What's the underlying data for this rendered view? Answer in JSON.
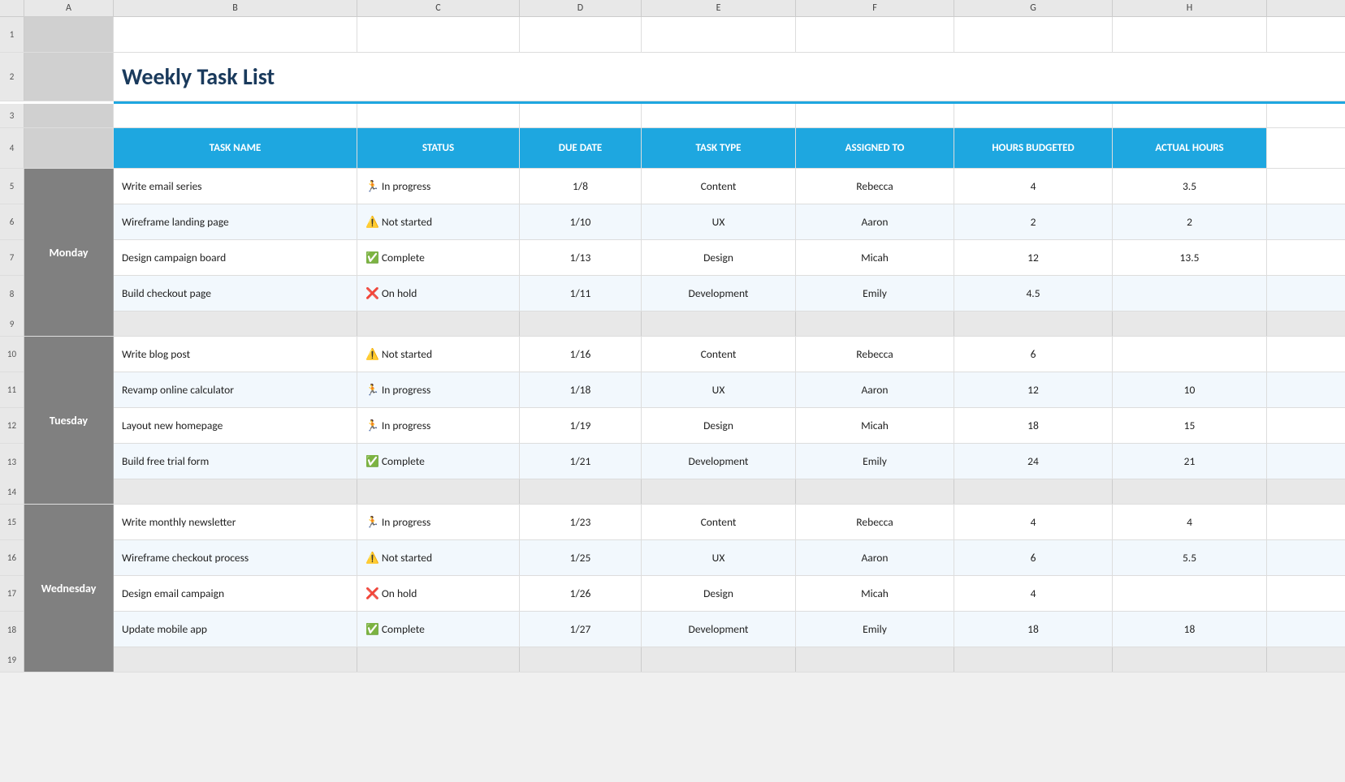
{
  "title": "Weekly Task List",
  "columns": {
    "rowNum": "#",
    "colA": "A",
    "colB": "B",
    "colC": "C",
    "colD": "D",
    "colE": "E",
    "colF": "F",
    "colG": "G",
    "colH": "H"
  },
  "headers": {
    "taskName": "TASK NAME",
    "status": "STATUS",
    "dueDate": "DUE DATE",
    "taskType": "TASK TYPE",
    "assignedTo": "ASSIGNED TO",
    "hoursBudgeted": "HOURS BUDGETED",
    "actualHours": "ACTUAL HOURS"
  },
  "groups": [
    {
      "day": "Monday",
      "startRow": 5,
      "rows": [
        {
          "rowNum": 5,
          "task": "Write email series",
          "statusIcon": "🏃",
          "status": "In progress",
          "dueDate": "1/8",
          "taskType": "Content",
          "assignedTo": "Rebecca",
          "hoursBudgeted": "4",
          "actualHours": "3.5"
        },
        {
          "rowNum": 6,
          "task": "Wireframe landing page",
          "statusIcon": "⚠️",
          "status": "Not started",
          "dueDate": "1/10",
          "taskType": "UX",
          "assignedTo": "Aaron",
          "hoursBudgeted": "2",
          "actualHours": "2"
        },
        {
          "rowNum": 7,
          "task": "Design campaign board",
          "statusIcon": "✅",
          "status": "Complete",
          "dueDate": "1/13",
          "taskType": "Design",
          "assignedTo": "Micah",
          "hoursBudgeted": "12",
          "actualHours": "13.5"
        },
        {
          "rowNum": 8,
          "task": "Build checkout page",
          "statusIcon": "❌",
          "status": "On hold",
          "dueDate": "1/11",
          "taskType": "Development",
          "assignedTo": "Emily",
          "hoursBudgeted": "4.5",
          "actualHours": ""
        }
      ],
      "emptyRow": 9
    },
    {
      "day": "Tuesday",
      "startRow": 10,
      "rows": [
        {
          "rowNum": 10,
          "task": "Write blog post",
          "statusIcon": "⚠️",
          "status": "Not started",
          "dueDate": "1/16",
          "taskType": "Content",
          "assignedTo": "Rebecca",
          "hoursBudgeted": "6",
          "actualHours": ""
        },
        {
          "rowNum": 11,
          "task": "Revamp online calculator",
          "statusIcon": "🏃",
          "status": "In progress",
          "dueDate": "1/18",
          "taskType": "UX",
          "assignedTo": "Aaron",
          "hoursBudgeted": "12",
          "actualHours": "10"
        },
        {
          "rowNum": 12,
          "task": "Layout new homepage",
          "statusIcon": "🏃",
          "status": "In progress",
          "dueDate": "1/19",
          "taskType": "Design",
          "assignedTo": "Micah",
          "hoursBudgeted": "18",
          "actualHours": "15"
        },
        {
          "rowNum": 13,
          "task": "Build free trial form",
          "statusIcon": "✅",
          "status": "Complete",
          "dueDate": "1/21",
          "taskType": "Development",
          "assignedTo": "Emily",
          "hoursBudgeted": "24",
          "actualHours": "21"
        }
      ],
      "emptyRow": 14
    },
    {
      "day": "Wednesday",
      "startRow": 15,
      "rows": [
        {
          "rowNum": 15,
          "task": "Write monthly newsletter",
          "statusIcon": "🏃",
          "status": "In progress",
          "dueDate": "1/23",
          "taskType": "Content",
          "assignedTo": "Rebecca",
          "hoursBudgeted": "4",
          "actualHours": "4"
        },
        {
          "rowNum": 16,
          "task": "Wireframe checkout process",
          "statusIcon": "⚠️",
          "status": "Not started",
          "dueDate": "1/25",
          "taskType": "UX",
          "assignedTo": "Aaron",
          "hoursBudgeted": "6",
          "actualHours": "5.5"
        },
        {
          "rowNum": 17,
          "task": "Design email campaign",
          "statusIcon": "❌",
          "status": "On hold",
          "dueDate": "1/26",
          "taskType": "Design",
          "assignedTo": "Micah",
          "hoursBudgeted": "4",
          "actualHours": ""
        },
        {
          "rowNum": 18,
          "task": "Update mobile app",
          "statusIcon": "✅",
          "status": "Complete",
          "dueDate": "1/27",
          "taskType": "Development",
          "assignedTo": "Emily",
          "hoursBudgeted": "18",
          "actualHours": "18"
        }
      ],
      "emptyRow": 19
    }
  ]
}
